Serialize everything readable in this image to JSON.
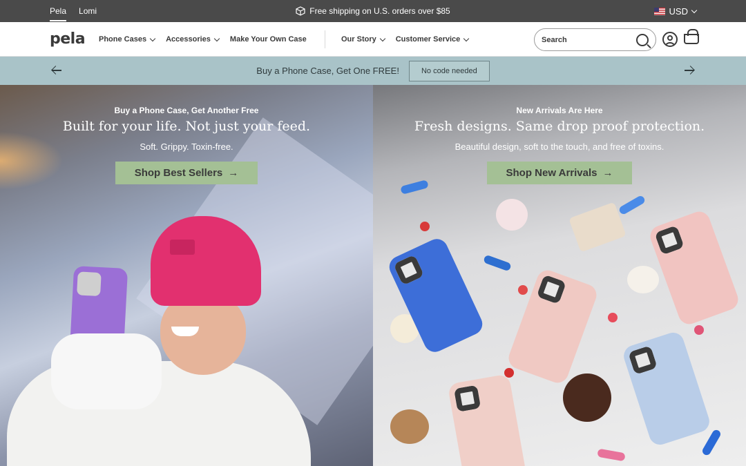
{
  "topbar": {
    "brands": [
      "Pela",
      "Lomi"
    ],
    "shipping": "Free shipping on U.S. orders over $85",
    "currency": "USD"
  },
  "nav": {
    "logo": "pela",
    "items": [
      "Phone Cases",
      "Accessories",
      "Make Your Own Case",
      "Our Story",
      "Customer Service"
    ],
    "search_placeholder": "Search"
  },
  "promo": {
    "text": "Buy a Phone Case, Get One FREE!",
    "code": "No code needed"
  },
  "hero_left": {
    "eyebrow": "Buy a Phone Case, Get Another Free",
    "headline": "Built for your life. Not just your feed.",
    "sub": "Soft. Grippy. Toxin-free.",
    "cta": "Shop Best Sellers"
  },
  "hero_right": {
    "eyebrow": "New Arrivals Are Here",
    "headline": "Fresh designs. Same drop proof protection.",
    "sub": "Beautiful design, soft to the touch, and free of toxins.",
    "cta": "Shop New Arrivals"
  },
  "colors": {
    "topbar": "#4a4a4a",
    "promo": "#a9c3c8",
    "cta": "#a4c095"
  },
  "icons": [
    "package-icon",
    "us-flag-icon",
    "chevron-down-icon",
    "search-icon",
    "account-icon",
    "cart-icon",
    "arrow-left-icon",
    "arrow-right-icon"
  ]
}
